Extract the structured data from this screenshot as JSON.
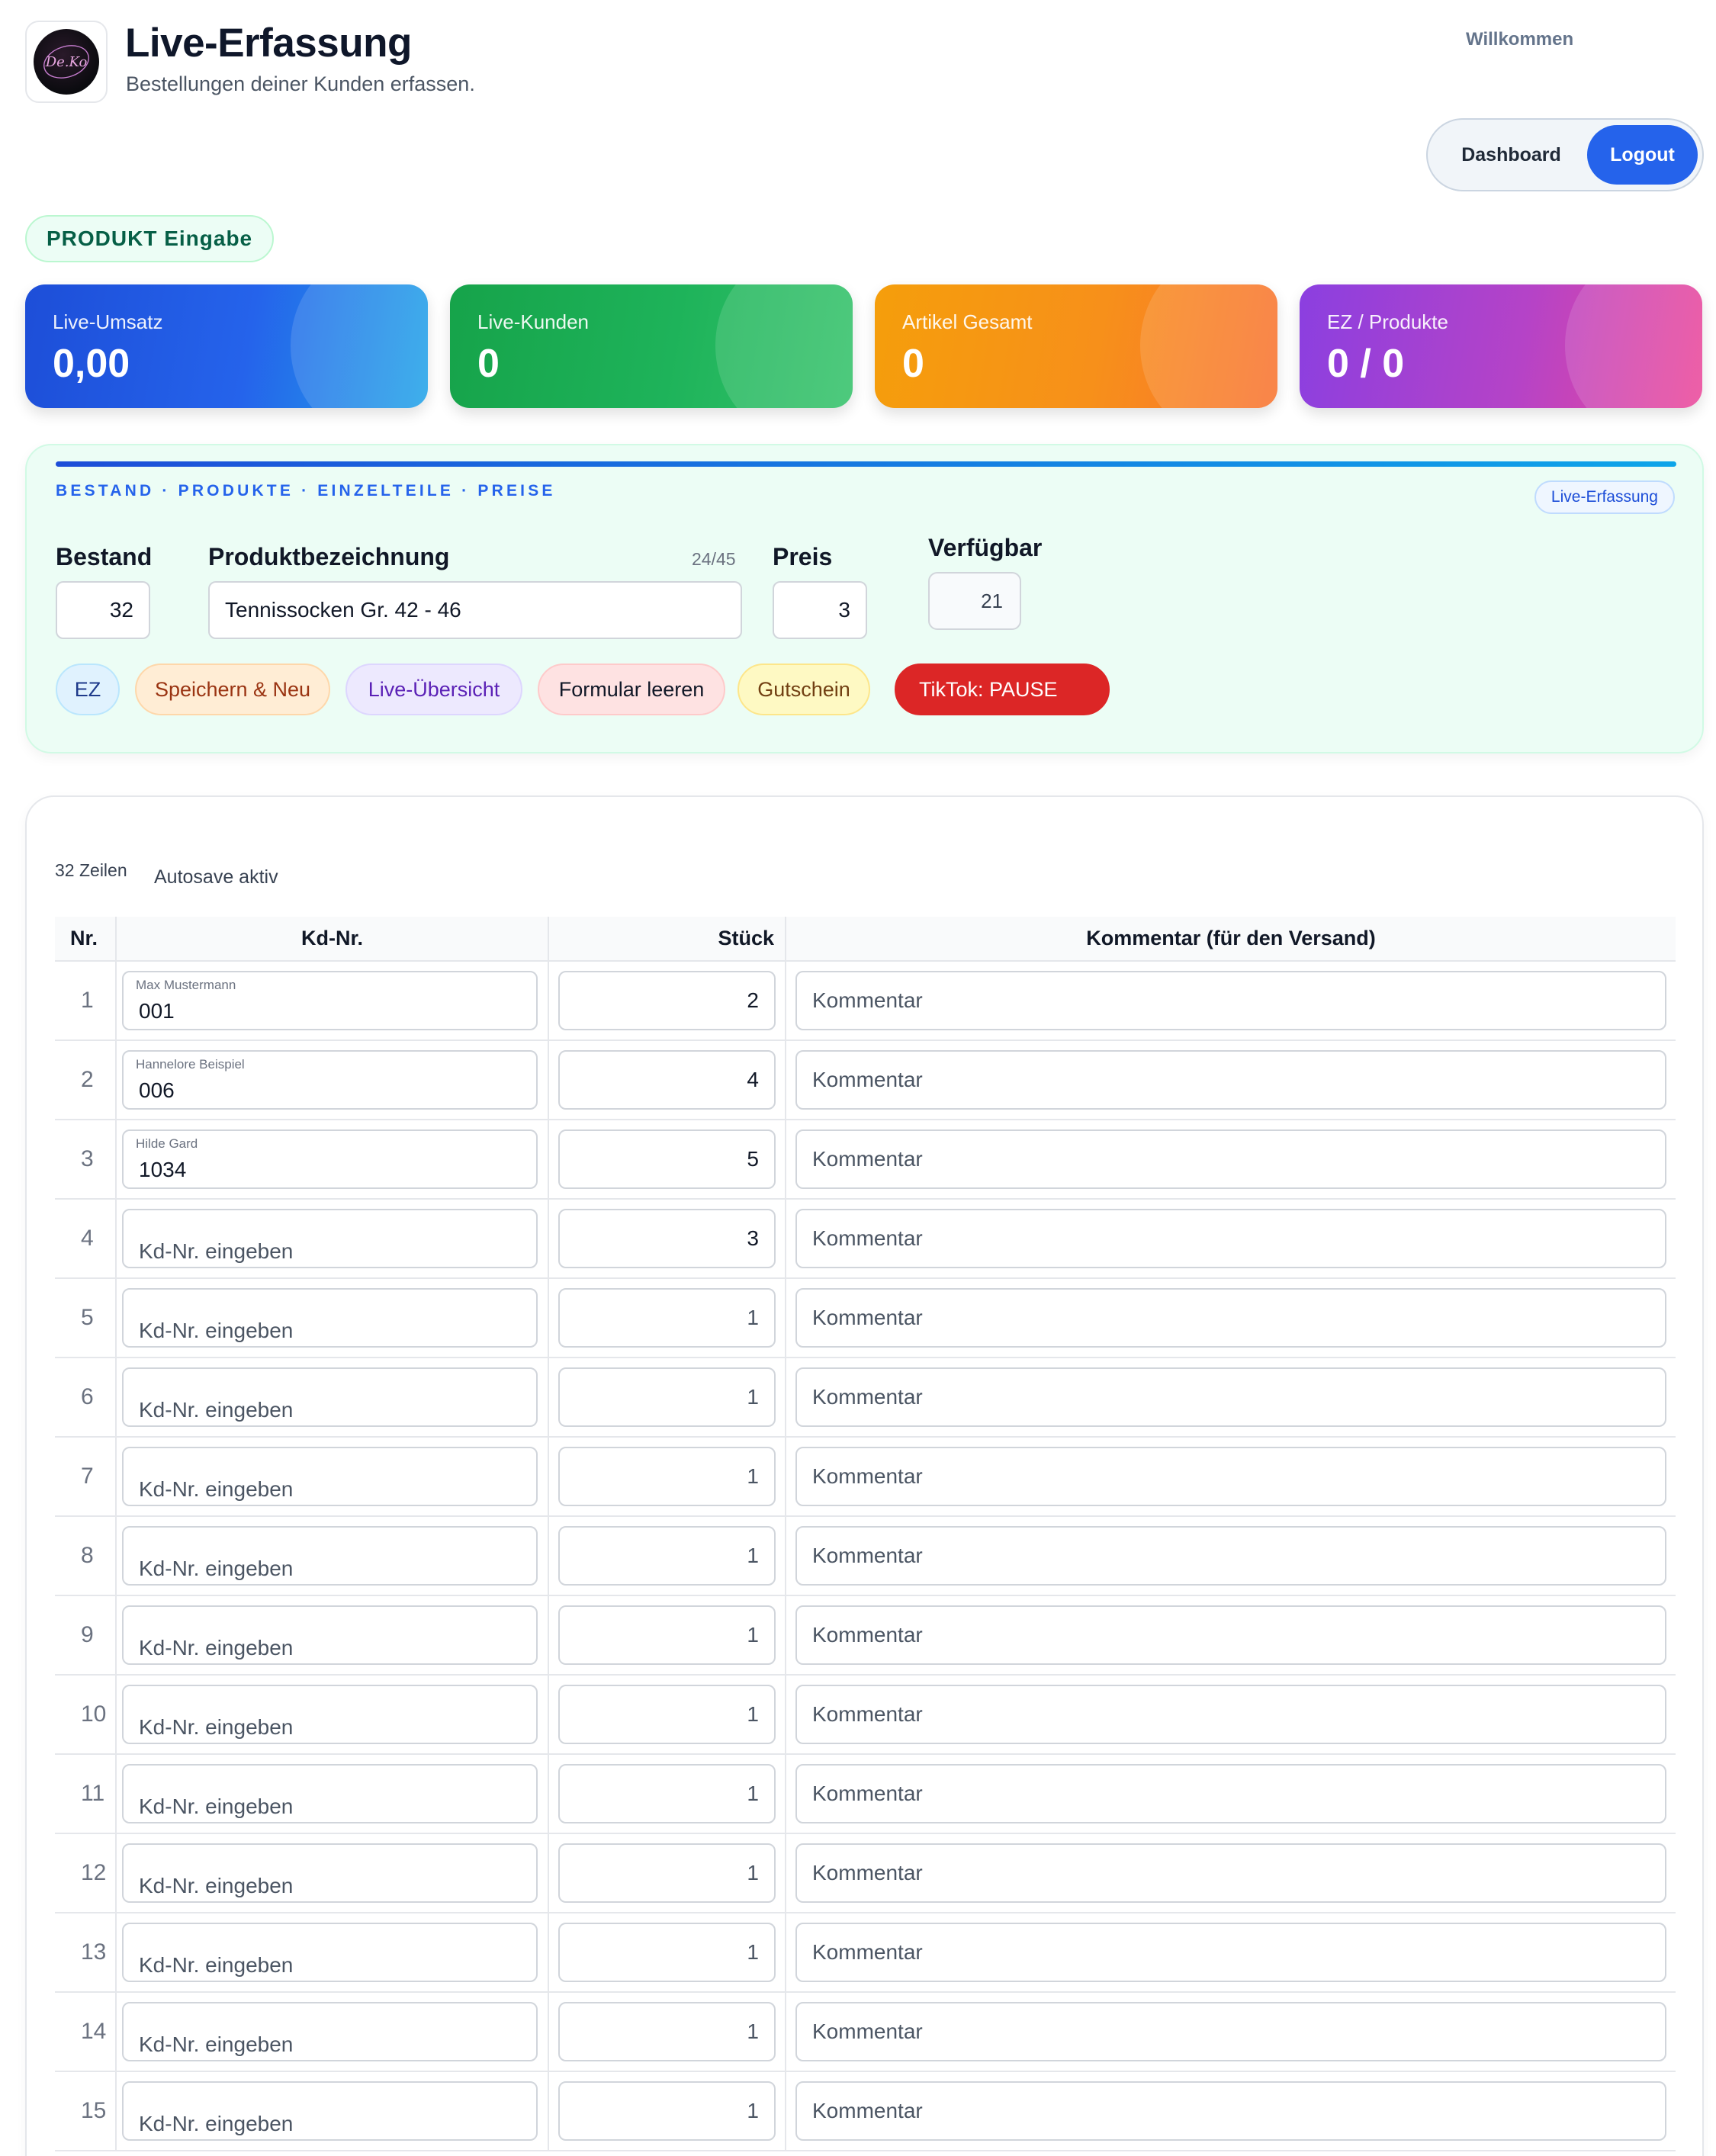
{
  "header": {
    "title": "Live-Erfassung",
    "subtitle": "Bestellungen deiner Kunden erfassen.",
    "welcome": "Willkommen",
    "logo_text": "De.Ko",
    "nav": {
      "dashboard": "Dashboard",
      "logout": "Logout"
    }
  },
  "mode_badge": "PRODUKT Eingabe",
  "stats": [
    {
      "label": "Live-Umsatz",
      "value": "0,00"
    },
    {
      "label": "Live-Kunden",
      "value": "0"
    },
    {
      "label": "Artikel Gesamt",
      "value": "0"
    },
    {
      "label": "EZ / Produkte",
      "value": "0 / 0"
    }
  ],
  "product": {
    "kicker": "BESTAND · PRODUKTE · EINZELTEILE · PREISE",
    "tag": "Live-Erfassung",
    "stock_label": "Bestand",
    "stock_value": "32",
    "name_label": "Produktbezeichnung",
    "name_counter": "24/45",
    "name_value": "Tennissocken Gr. 42 - 46",
    "price_label": "Preis",
    "price_value": "3",
    "available_label": "Verfügbar",
    "available_value": "21",
    "actions": {
      "ez": "EZ",
      "save_new": "Speichern & Neu",
      "live_overview": "Live-Übersicht",
      "clear_form": "Formular leeren",
      "voucher": "Gutschein",
      "tiktok": "TikTok: PAUSE"
    }
  },
  "orders": {
    "rows_count": "32 Zeilen",
    "autosave": "Autosave aktiv",
    "columns": {
      "nr": "Nr.",
      "customer": "Kd-Nr.",
      "qty": "Stück",
      "comment": "Kommentar (für den Versand)"
    },
    "customer_placeholder": "Kd-Nr. eingeben",
    "comment_placeholder": "Kommentar",
    "rows": [
      {
        "nr": "1",
        "name": "Max Mustermann",
        "kd": "001",
        "qty": "2",
        "set": true
      },
      {
        "nr": "2",
        "name": "Hannelore Beispiel",
        "kd": "006",
        "qty": "4",
        "set": true
      },
      {
        "nr": "3",
        "name": "Hilde Gard",
        "kd": "1034",
        "qty": "5",
        "set": true
      },
      {
        "nr": "4",
        "name": "",
        "kd": "",
        "qty": "3",
        "set": true
      },
      {
        "nr": "5",
        "name": "",
        "kd": "",
        "qty": "1",
        "set": false
      },
      {
        "nr": "6",
        "name": "",
        "kd": "",
        "qty": "1",
        "set": false
      },
      {
        "nr": "7",
        "name": "",
        "kd": "",
        "qty": "1",
        "set": false
      },
      {
        "nr": "8",
        "name": "",
        "kd": "",
        "qty": "1",
        "set": false
      },
      {
        "nr": "9",
        "name": "",
        "kd": "",
        "qty": "1",
        "set": false
      },
      {
        "nr": "10",
        "name": "",
        "kd": "",
        "qty": "1",
        "set": false
      },
      {
        "nr": "11",
        "name": "",
        "kd": "",
        "qty": "1",
        "set": false
      },
      {
        "nr": "12",
        "name": "",
        "kd": "",
        "qty": "1",
        "set": false
      },
      {
        "nr": "13",
        "name": "",
        "kd": "",
        "qty": "1",
        "set": false
      },
      {
        "nr": "14",
        "name": "",
        "kd": "",
        "qty": "1",
        "set": false
      },
      {
        "nr": "15",
        "name": "",
        "kd": "",
        "qty": "1",
        "set": false
      }
    ]
  },
  "colors": {
    "primary": "#2563eb",
    "danger": "#dc2626",
    "panel_bg": "#ecfdf5"
  }
}
